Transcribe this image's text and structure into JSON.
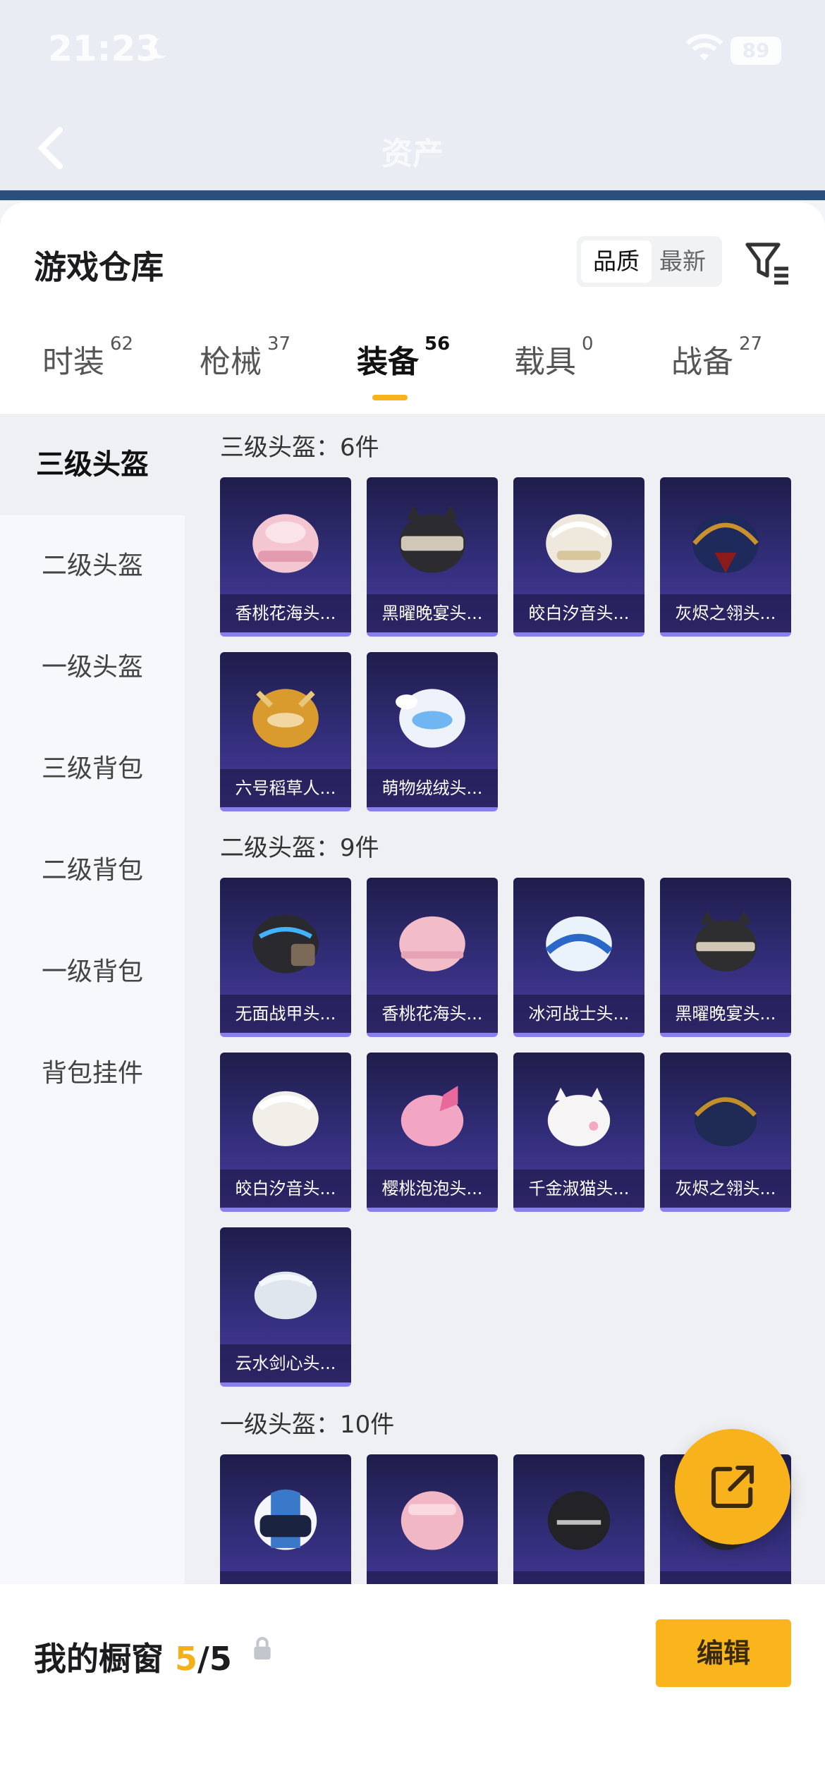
{
  "status": {
    "time": "21:23",
    "battery": "89"
  },
  "nav": {
    "title": "资产"
  },
  "header": {
    "title": "游戏仓库",
    "sort_quality": "品质",
    "sort_latest": "最新"
  },
  "tabs": [
    {
      "label": "时装",
      "count": "62"
    },
    {
      "label": "枪械",
      "count": "37"
    },
    {
      "label": "装备",
      "count": "56"
    },
    {
      "label": "载具",
      "count": "0"
    },
    {
      "label": "战备",
      "count": "27"
    }
  ],
  "sidebar": [
    "三级头盔",
    "二级头盔",
    "一级头盔",
    "三级背包",
    "二级背包",
    "一级背包",
    "背包挂件"
  ],
  "sections": [
    {
      "title": "三级头盔：6件",
      "items": [
        "香桃花海头...",
        "黑曜晚宴头...",
        "皎白汐音头...",
        "灰烬之翎头...",
        "六号稻草人...",
        "萌物绒绒头..."
      ]
    },
    {
      "title": "二级头盔：9件",
      "items": [
        "无面战甲头...",
        "香桃花海头...",
        "冰河战士头...",
        "黑曜晚宴头...",
        "皎白汐音头...",
        "樱桃泡泡头...",
        "千金淑猫头...",
        "灰烬之翎头...",
        "云水剑心头..."
      ]
    },
    {
      "title": "一级头盔：10件",
      "items": [
        "",
        "",
        "",
        ""
      ]
    }
  ],
  "colors": {
    "accent": "#f8b21b",
    "card_bg": "#332e7b"
  },
  "bottom": {
    "label": "我的橱窗",
    "count_current": "5",
    "count_total": "/5",
    "edit_label": "编辑"
  }
}
